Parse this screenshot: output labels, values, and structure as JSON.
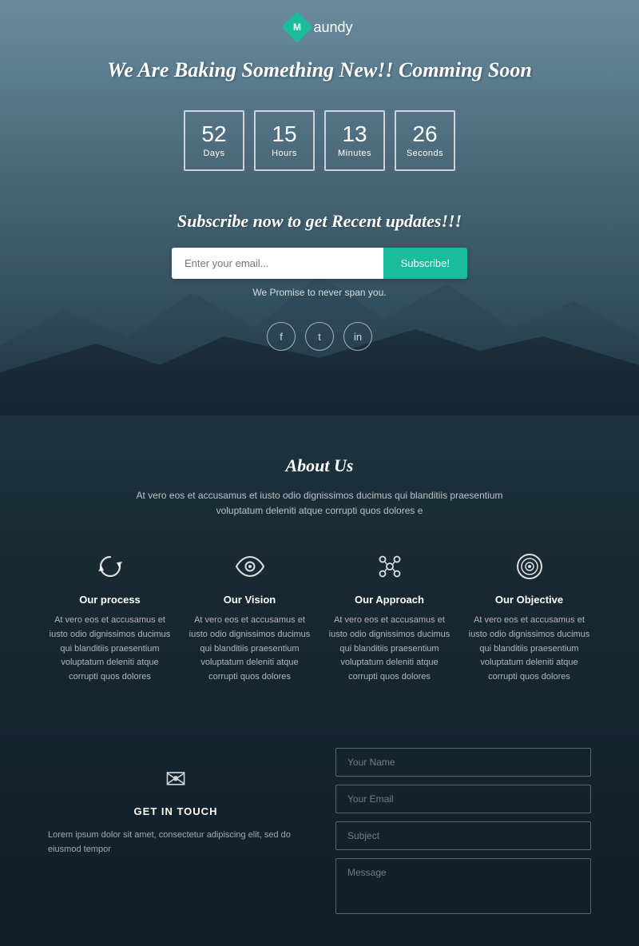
{
  "logo": {
    "letter": "M",
    "name": "aundy"
  },
  "hero": {
    "headline": "We Are Baking Something New!! Comming Soon"
  },
  "countdown": {
    "days": {
      "value": "52",
      "label": "Days"
    },
    "hours": {
      "value": "15",
      "label": "Hours"
    },
    "minutes": {
      "value": "13",
      "label": "Minutes"
    },
    "seconds": {
      "value": "26",
      "label": "Seconds"
    }
  },
  "subscribe": {
    "title": "Subscribe now to get Recent updates!!!",
    "input_placeholder": "Enter your email...",
    "button_label": "Subscribe!",
    "note": "We Promise to never span you."
  },
  "social": {
    "facebook": "f",
    "twitter": "t",
    "linkedin": "in"
  },
  "about": {
    "title": "About Us",
    "description": "At vero eos et accusamus et iusto odio dignissimos ducimus qui blanditiis praesentium voluptatum deleniti atque corrupti quos dolores e"
  },
  "features": [
    {
      "id": "process",
      "title": "Our process",
      "text": "At vero eos et accusamus et iusto odio dignissimos ducimus qui blanditiis praesentium voluptatum deleniti atque corrupti quos dolores"
    },
    {
      "id": "vision",
      "title": "Our Vision",
      "text": "At vero eos et accusamus et iusto odio dignissimos ducimus qui blanditiis praesentium voluptatum deleniti atque corrupti quos dolores"
    },
    {
      "id": "approach",
      "title": "Our Approach",
      "text": "At vero eos et accusamus et iusto odio dignissimos ducimus qui blanditiis praesentium voluptatum deleniti atque corrupti quos dolores"
    },
    {
      "id": "objective",
      "title": "Our Objective",
      "text": "At vero eos et accusamus et iusto odio dignissimos ducimus qui blanditiis praesentium voluptatum deleniti atque corrupti quos dolores"
    }
  ],
  "contact": {
    "icon": "✉",
    "title": "GET IN TOUCH",
    "text": "Lorem ipsum dolor sit amet, consectetur adipiscing elit, sed do eiusmod tempor",
    "name_placeholder": "Your Name",
    "email_placeholder": "Your Email",
    "subject_placeholder": "Subject",
    "message_placeholder": "Message"
  }
}
